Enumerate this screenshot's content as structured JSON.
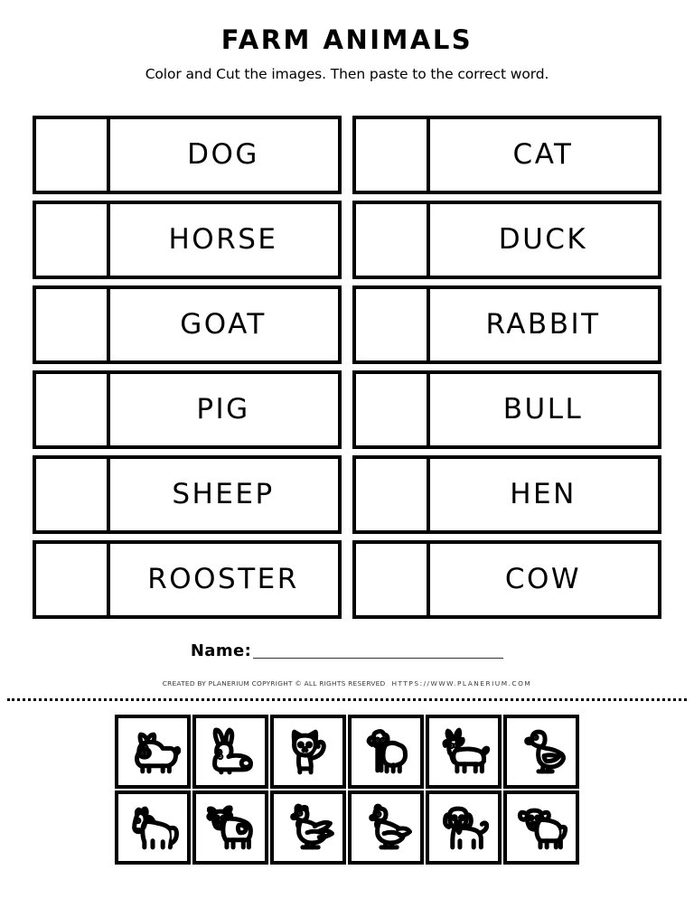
{
  "header": {
    "title": "FARM ANIMALS",
    "subtitle": "Color and Cut the images. Then paste to the correct word."
  },
  "word_rows": [
    {
      "left": "DOG",
      "right": "CAT"
    },
    {
      "left": "HORSE",
      "right": "DUCK"
    },
    {
      "left": "GOAT",
      "right": "RABBIT"
    },
    {
      "left": "PIG",
      "right": "BULL"
    },
    {
      "left": "SHEEP",
      "right": "HEN"
    },
    {
      "left": "ROOSTER",
      "right": "COW"
    }
  ],
  "name_field": {
    "label": "Name:",
    "value": ""
  },
  "footer": {
    "credit": "CREATED BY PLANERIUM COPYRIGHT © ALL RIGHTS RESERVED",
    "url": "HTTPS://WWW.PLANERIUM.COM"
  },
  "picture_rows": [
    [
      {
        "icon": "pig-icon",
        "label": "pig"
      },
      {
        "icon": "rabbit-icon",
        "label": "rabbit"
      },
      {
        "icon": "cat-icon",
        "label": "cat"
      },
      {
        "icon": "sheep-icon",
        "label": "sheep"
      },
      {
        "icon": "goat-icon",
        "label": "goat"
      },
      {
        "icon": "duck-icon",
        "label": "duck"
      }
    ],
    [
      {
        "icon": "horse-icon",
        "label": "horse"
      },
      {
        "icon": "cow-icon",
        "label": "cow"
      },
      {
        "icon": "rooster-icon",
        "label": "rooster"
      },
      {
        "icon": "hen-icon",
        "label": "hen"
      },
      {
        "icon": "dog-icon",
        "label": "dog"
      },
      {
        "icon": "bull-icon",
        "label": "bull"
      }
    ]
  ],
  "colors": {
    "ink": "#000000",
    "paper": "#ffffff",
    "credit_text": "#3a3a3a"
  }
}
